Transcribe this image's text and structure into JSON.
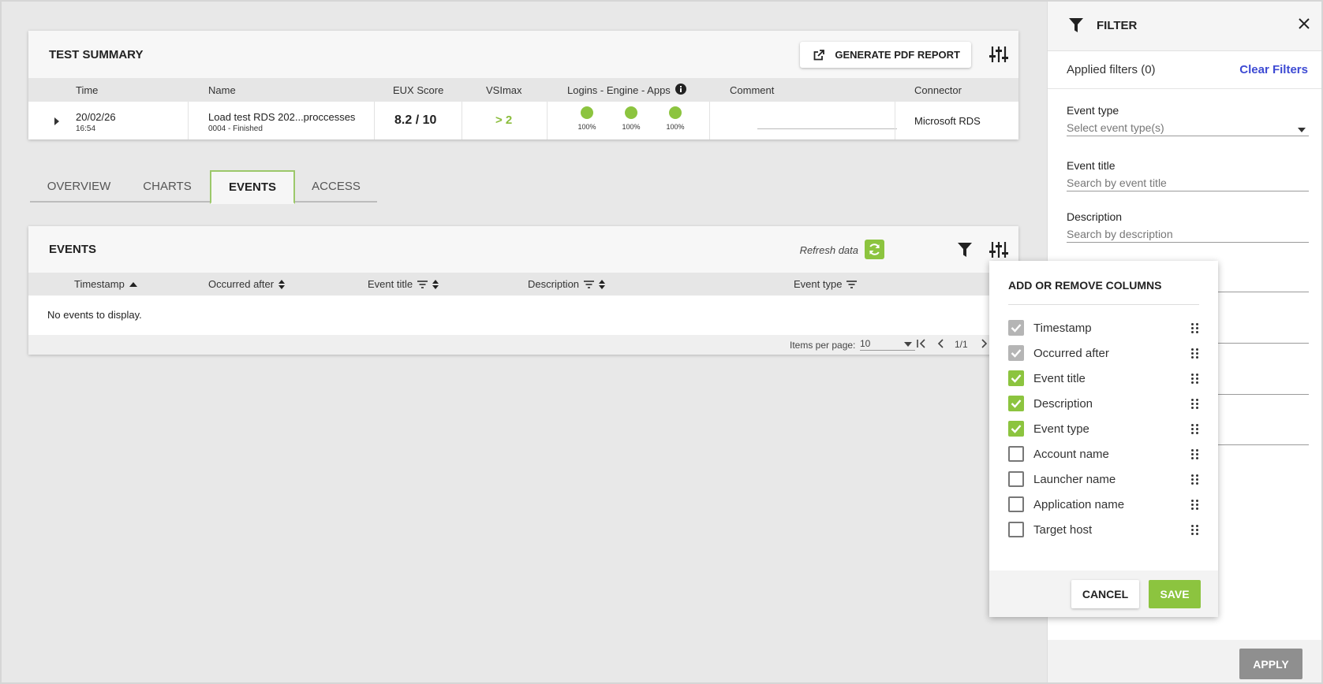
{
  "summary": {
    "title": "TEST SUMMARY",
    "pdf_button": "GENERATE PDF REPORT",
    "columns": [
      "Time",
      "Name",
      "EUX Score",
      "VSImax",
      "Logins - Engine - Apps",
      "Comment",
      "Connector"
    ],
    "row": {
      "date": "20/02/26",
      "time": "16:54",
      "name": "Load test RDS 202...proccesses",
      "status": "0004 - Finished",
      "eux": "8.2 / 10",
      "vsimax": "> 2",
      "logins_pct": "100%",
      "engine_pct": "100%",
      "apps_pct": "100%",
      "comment": "",
      "connector": "Microsoft RDS"
    }
  },
  "tabs": [
    {
      "label": "OVERVIEW",
      "active": false
    },
    {
      "label": "CHARTS",
      "active": false
    },
    {
      "label": "EVENTS",
      "active": true
    },
    {
      "label": "ACCESS",
      "active": false
    }
  ],
  "events": {
    "title": "EVENTS",
    "refresh_label": "Refresh data",
    "columns": [
      "Timestamp",
      "Occurred after",
      "Event title",
      "Description",
      "Event type"
    ],
    "empty_text": "No events to display.",
    "items_per_page_label": "Items per page:",
    "items_per_page": "10",
    "page": "1/1"
  },
  "filter": {
    "title": "FILTER",
    "applied": "Applied filters (0)",
    "clear": "Clear Filters",
    "event_type_label": "Event type",
    "event_type_placeholder": "Select event type(s)",
    "event_title_label": "Event title",
    "event_title_placeholder": "Search by event title",
    "description_label": "Description",
    "description_placeholder": "Search by description",
    "apply": "APPLY"
  },
  "columns_popup": {
    "title": "ADD OR REMOVE COLUMNS",
    "items": [
      {
        "label": "Timestamp",
        "state": "disabled"
      },
      {
        "label": "Occurred after",
        "state": "disabled"
      },
      {
        "label": "Event title",
        "state": "checked"
      },
      {
        "label": "Description",
        "state": "checked"
      },
      {
        "label": "Event type",
        "state": "checked"
      },
      {
        "label": "Account name",
        "state": "unchecked"
      },
      {
        "label": "Launcher name",
        "state": "unchecked"
      },
      {
        "label": "Application name",
        "state": "unchecked"
      },
      {
        "label": "Target host",
        "state": "unchecked"
      }
    ],
    "cancel": "CANCEL",
    "save": "SAVE"
  },
  "colors": {
    "accent": "#8cc43f",
    "link": "#3d4ad3",
    "apply_disabled": "#8f8f8f"
  }
}
